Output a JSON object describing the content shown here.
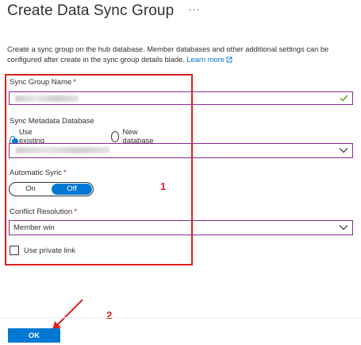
{
  "header": {
    "title": "Create Data Sync Group",
    "more_icon": "more-options-icon",
    "more_glyph": "···"
  },
  "description": {
    "text": "Create a sync group on the hub database. Member databases and other additional settings can be configured after create in the sync group details blade.",
    "link_text": "Learn more",
    "link_icon": "external-link-icon",
    "link_color": "#0078d4"
  },
  "form": {
    "sync_group_name": {
      "label": "Sync Group Name",
      "required_mark": "*",
      "status_icon": "checkmark-icon"
    },
    "sync_metadata_database": {
      "label": "Sync Metadata Database",
      "options": [
        {
          "label": "Use existing database",
          "selected": true
        },
        {
          "label": "New database",
          "selected": false
        }
      ],
      "dropdown_icon": "chevron-down-icon"
    },
    "automatic_sync": {
      "label": "Automatic Sync",
      "required_mark": "*",
      "on_label": "On",
      "off_label": "Off",
      "selected": "Off"
    },
    "conflict_resolution": {
      "label": "Conflict Resolution",
      "required_mark": "*",
      "value": "Member win",
      "dropdown_icon": "chevron-down-icon"
    },
    "private_link": {
      "label": "Use private link",
      "checked": false
    }
  },
  "annotations": {
    "box_number": "1",
    "button_number": "2",
    "color": "#e0201e"
  },
  "footer": {
    "ok_label": "OK"
  },
  "colors": {
    "accent": "#0078d4",
    "focus_border": "#8a2b8c",
    "valid": "#57a300",
    "required": "#a4262c"
  }
}
